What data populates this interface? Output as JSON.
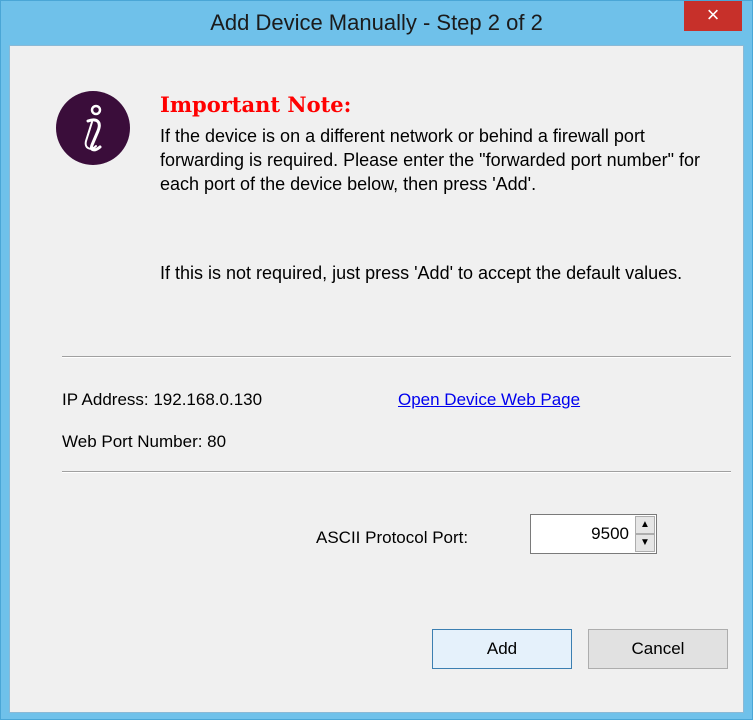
{
  "window": {
    "title": "Add Device Manually - Step 2 of 2",
    "close_label": "×",
    "accent_color": "#6fc1ea",
    "close_color": "#c7302a"
  },
  "note": {
    "icon": "info-icon",
    "title": "Important Note:",
    "paragraph1": "If the device is on a different network or behind a firewall port forwarding is required. Please enter the \"forwarded port number\" for each port of the device below, then press 'Add'.",
    "paragraph2": "If this is not required, just press 'Add' to accept the default values.",
    "title_color": "#ff0000"
  },
  "device": {
    "ip_label": "IP Address: 192.168.0.130",
    "web_link": "Open Device Web Page",
    "web_port_label": "Web Port Number: 80"
  },
  "ascii": {
    "label": "ASCII Protocol Port:",
    "value": "9500",
    "up_glyph": "▲",
    "down_glyph": "▼"
  },
  "buttons": {
    "add": "Add",
    "cancel": "Cancel"
  }
}
